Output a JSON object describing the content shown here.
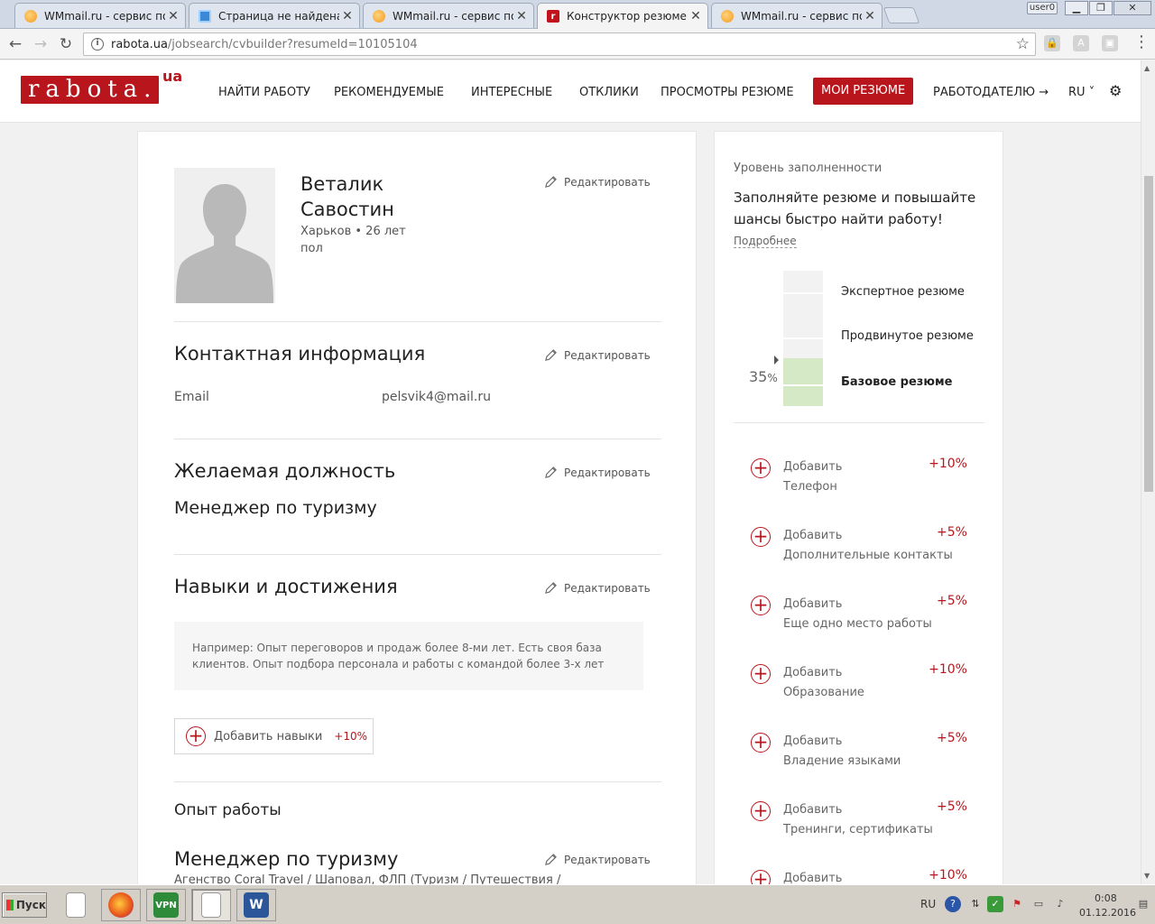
{
  "browser": {
    "tabs": [
      {
        "title": "WMmail.ru - сервис почтов",
        "favicon": "wm-icon",
        "active": false
      },
      {
        "title": "Страница не найдена",
        "favicon": "globe-icon",
        "active": false
      },
      {
        "title": "WMmail.ru - сервис почтов",
        "favicon": "wm-icon",
        "active": false
      },
      {
        "title": "Конструктор резюме",
        "favicon": "rabota-icon",
        "active": true
      },
      {
        "title": "WMmail.ru - сервис почтов",
        "favicon": "wm-icon",
        "active": false
      }
    ],
    "close_glyph": "✕",
    "user_label": "user0",
    "url_host": "rabota.ua",
    "url_path": "/jobsearch/cvbuilder?resumeId=10105104"
  },
  "site": {
    "logo_text": "rabota.",
    "logo_suffix": "ua",
    "nav": [
      "НАЙТИ РАБОТУ",
      "РЕКОМЕНДУЕМЫЕ",
      "ИНТЕРЕСНЫЕ",
      "ОТКЛИКИ",
      "ПРОСМОТРЫ РЕЗЮМЕ",
      "МОИ РЕЗЮМЕ",
      "РАБОТОДАТЕЛЮ →",
      "RU ˅"
    ],
    "active_nav": "МОИ РЕЗЮМЕ",
    "accent_color": "#b8151c"
  },
  "resume": {
    "first_name": "Веталик",
    "last_name": "Савостин",
    "city_age": "Харьков • 26 лет",
    "gender": "пол",
    "edit_label": "Редактировать",
    "contact": {
      "title": "Контактная информация",
      "email_label": "Email",
      "email_value": "pelsvik4@mail.ru"
    },
    "position": {
      "title": "Желаемая должность",
      "value": "Менеджер по туризму"
    },
    "skills": {
      "title": "Навыки и достижения",
      "hint": "Например: Опыт переговоров и продаж более 8-ми лет. Есть своя база клиентов. Опыт подбора персонала и работы с командой более 3-х лет",
      "add_label": "Добавить навыки",
      "add_pct": "+10%"
    },
    "experience": {
      "title": "Опыт работы",
      "job_title": "Менеджер по туризму",
      "job_sub": "Агенство Coral Travel / Шаповал, ФЛП (Туризм / Путешествия /"
    }
  },
  "completeness": {
    "title": "Уровень заполненности",
    "lead": "Заполняйте резюме и повышайте шансы быстро найти работу!",
    "more": "Подробнее",
    "percent_value": 35,
    "percent_label": "35",
    "percent_sign": "%",
    "levels": [
      "Экспертное резюме",
      "Продвинутое резюме",
      "Базовое резюме"
    ],
    "current_level": "Базовое резюме",
    "add_label": "Добавить",
    "items": [
      {
        "name": "Телефон",
        "pct": "+10%"
      },
      {
        "name": "Дополнительные контакты",
        "pct": "+5%"
      },
      {
        "name": "Еще одно место работы",
        "pct": "+5%"
      },
      {
        "name": "Образование",
        "pct": "+10%"
      },
      {
        "name": "Владение языками",
        "pct": "+5%"
      },
      {
        "name": "Тренинги, сертификаты",
        "pct": "+5%"
      },
      {
        "name": "",
        "pct": "+10%"
      }
    ]
  },
  "taskbar": {
    "start_label": "Пуск",
    "lang": "RU",
    "time": "0:08",
    "date": "01.12.2016"
  }
}
